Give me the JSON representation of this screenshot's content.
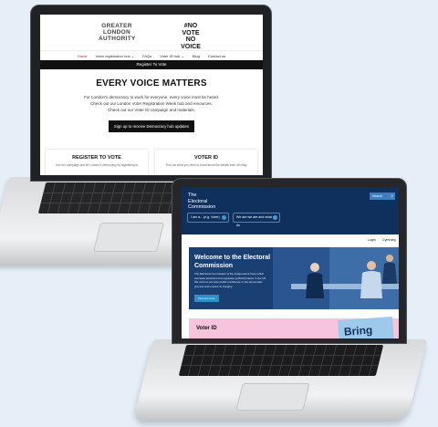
{
  "site1": {
    "logo_text": "GREATER LONDON AUTHORITY",
    "novote_text": "#NO VOTE NO VOICE",
    "nav": [
      "Home",
      "Voter registration hub ⌄",
      "FAQs",
      "Voter ID hub ⌄",
      "Blog",
      "Contact us"
    ],
    "bar": "Register To Vote",
    "headline": "EVERY VOICE MATTERS",
    "para_lines": [
      "For London's democracy to work for everyone, every voice must be heard.",
      "Check out our London Voter Registration Week hub and resources.",
      "Check out our Voter ID campaign and materials."
    ],
    "button": "Sign up to receive Democracy hub updates",
    "card1_title": "REGISTER TO VOTE",
    "card1_sub": "Join our campaign and be London's democracy by registering to",
    "card2_title": "VOTER ID",
    "card2_sub": "Find out what you need to know about the details from 4th May"
  },
  "site2": {
    "logo_lines": [
      "The",
      "Electoral",
      "Commission"
    ],
    "search": "Search",
    "pill1": "I am a... (e.g. Voter)",
    "pill2": "We are we are and what we do",
    "link1": "Login",
    "link2": "Cymraeg",
    "hero_title": "Welcome to the Electoral Commission",
    "hero_text": "The Electoral Commission is the independent body which oversees elections and regulates political finance in the UK. We work to promote public confidence in the democratic process and ensure its integrity.",
    "hero_button": "Find out more",
    "voter_title": "Voter ID",
    "bring": "Bring"
  },
  "colors": {
    "page_bg": "#e6eff8",
    "ec_navy": "#0f2f5c",
    "ec_blue": "#3c7fc1",
    "gla_pink": "#d9184f",
    "voter_pink": "#f7c4dd"
  }
}
